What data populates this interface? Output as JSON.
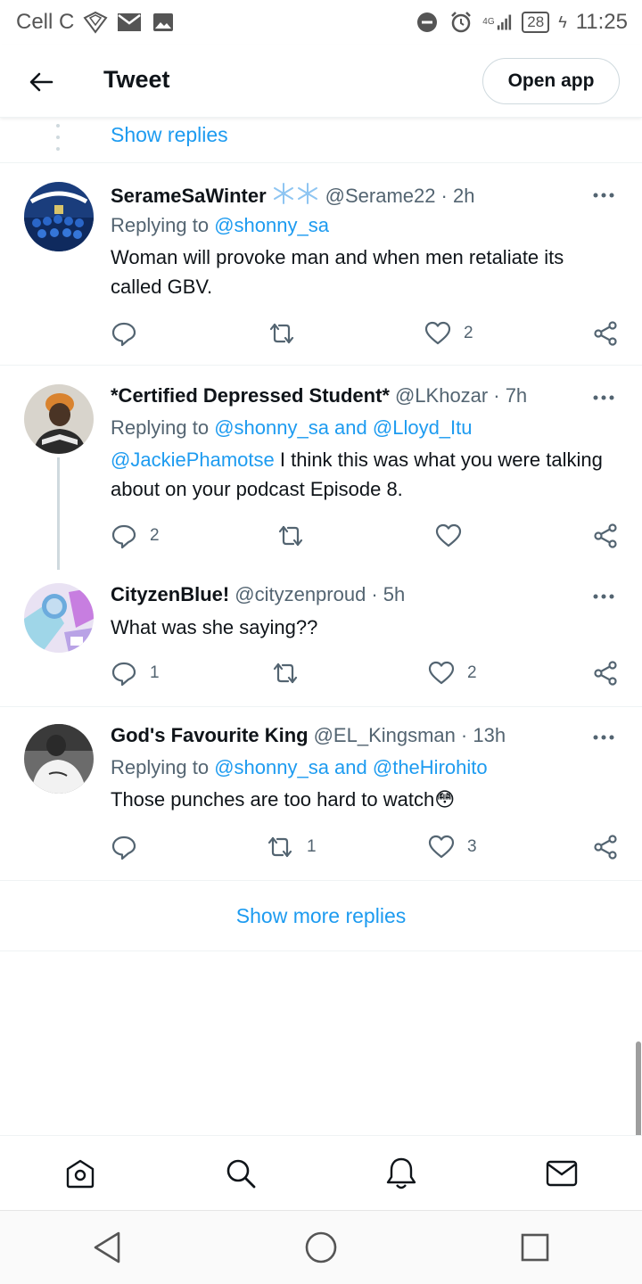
{
  "status_bar": {
    "carrier": "Cell C",
    "network": "4G",
    "battery": "28",
    "time": "11:25"
  },
  "header": {
    "title": "Tweet",
    "open_app_label": "Open app"
  },
  "show_replies_label": "Show replies",
  "tweets": [
    {
      "name": "SerameSaWinter",
      "handle": "@Serame22",
      "time": "· 2h",
      "replying_prefix": "Replying to",
      "replying_to": "@shonny_sa",
      "text": "Woman will provoke man and when men retaliate its called GBV.",
      "replies": "",
      "retweets": "",
      "likes": "2"
    },
    {
      "name": "*Certified Depressed Student*",
      "handle": "@LKhozar",
      "time": "· 7h",
      "replying_prefix": "Replying to",
      "replying_to": "@shonny_sa and @Lloyd_Itu",
      "text_mention": "@JackiePhamotse",
      "text": " I think this was what you were talking about on your podcast Episode 8.",
      "replies": "2",
      "retweets": "",
      "likes": ""
    },
    {
      "name": "CityzenBlue!",
      "handle": "@cityzenproud",
      "time": "· 5h",
      "text": "What was she saying??",
      "replies": "1",
      "retweets": "",
      "likes": "2"
    },
    {
      "name": "God's Favourite King",
      "handle": "@EL_Kingsman",
      "time": "· 13h",
      "replying_prefix": "Replying to",
      "replying_to": "@shonny_sa and @theHirohito",
      "text": "Those punches are too hard to watch😳",
      "replies": "",
      "retweets": "1",
      "likes": "3"
    }
  ],
  "show_more_label": "Show more replies",
  "colors": {
    "accent": "#1d9bf0",
    "text": "#0f1419",
    "muted": "#536471",
    "border": "#eff3f4"
  }
}
